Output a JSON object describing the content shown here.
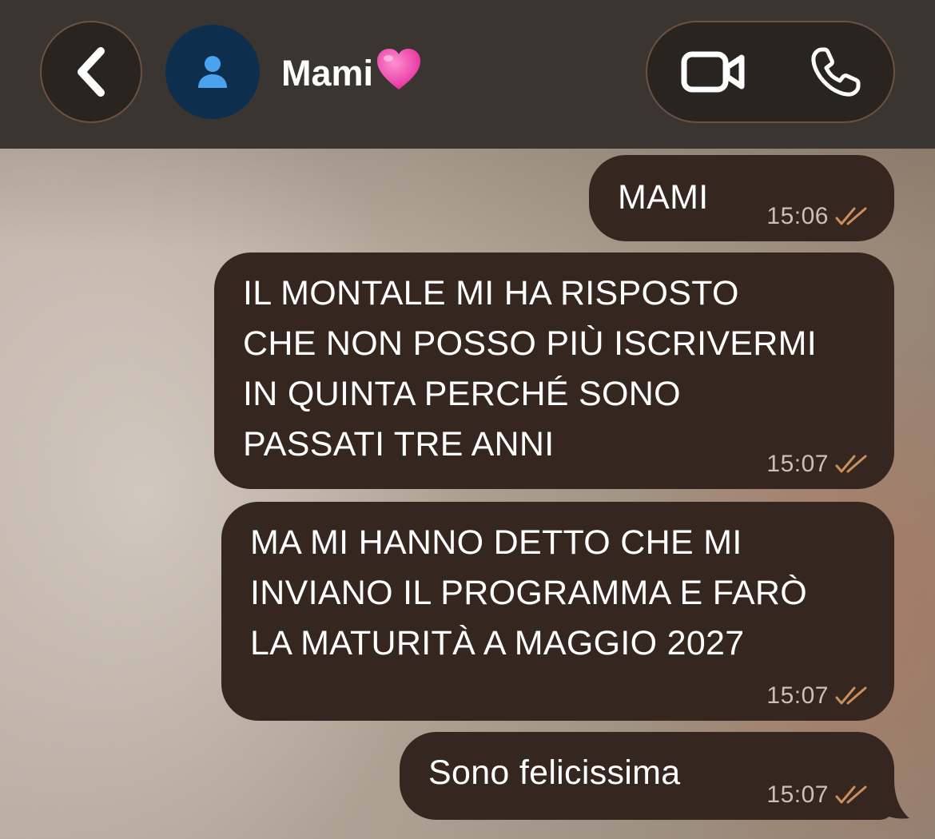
{
  "header": {
    "back_icon": "chevron-left-icon",
    "avatar_icon": "person-icon",
    "contact_name": "Mami",
    "contact_emoji": "💓",
    "video_call_icon": "video-camera-icon",
    "voice_call_icon": "phone-icon"
  },
  "messages": [
    {
      "text": "MAMI",
      "time": "15:06",
      "status": "read"
    },
    {
      "text": "IL MONTALE MI HA RISPOSTO\nCHE NON POSSO PIÙ ISCRIVERMI\nIN QUINTA PERCHÉ SONO\nPASSATI TRE ANNI",
      "time": "15:07",
      "status": "read"
    },
    {
      "text": "MA MI HANNO DETTO CHE MI\nINVIANO IL PROGRAMMA E FARÒ\nLA MATURITÀ A MAGGIO 2027",
      "time": "15:07",
      "status": "read"
    },
    {
      "text": "Sono felicissima",
      "time": "15:07",
      "status": "read"
    }
  ],
  "colors": {
    "header_bg": "#3b3532",
    "bubble_bg": "#35261f",
    "avatar_bg": "#0e2e4d",
    "avatar_icon": "#4aa3ee",
    "read_check": "#c98f5e"
  }
}
